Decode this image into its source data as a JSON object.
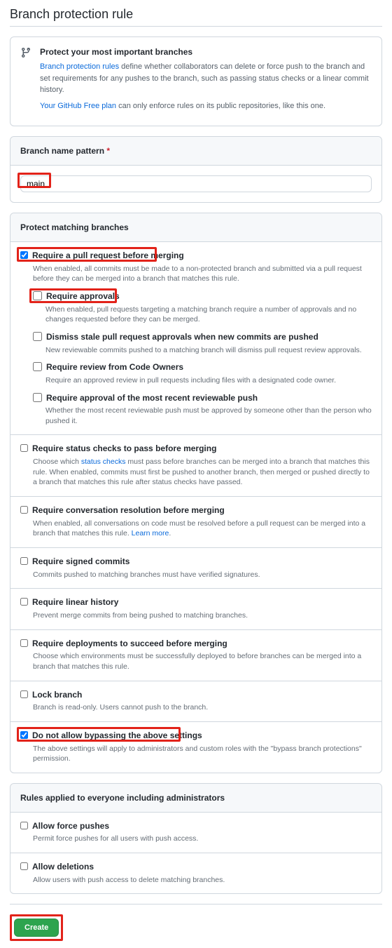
{
  "page_title": "Branch protection rule",
  "info": {
    "title": "Protect your most important branches",
    "link1": "Branch protection rules",
    "desc1": " define whether collaborators can delete or force push to the branch and set requirements for any pushes to the branch, such as passing status checks or a linear commit history.",
    "link2": "Your GitHub Free plan",
    "desc2": " can only enforce rules on its public repositories, like this one."
  },
  "pattern": {
    "header": "Branch name pattern",
    "value": "main"
  },
  "protect_header": "Protect matching branches",
  "rules": {
    "pr": {
      "label": "Require a pull request before merging",
      "desc": "When enabled, all commits must be made to a non-protected branch and submitted via a pull request before they can be merged into a branch that matches this rule."
    },
    "approvals": {
      "label": "Require approvals",
      "desc": "When enabled, pull requests targeting a matching branch require a number of approvals and no changes requested before they can be merged."
    },
    "dismiss": {
      "label": "Dismiss stale pull request approvals when new commits are pushed",
      "desc": "New reviewable commits pushed to a matching branch will dismiss pull request review approvals."
    },
    "codeowners": {
      "label": "Require review from Code Owners",
      "desc": "Require an approved review in pull requests including files with a designated code owner."
    },
    "lastpush": {
      "label": "Require approval of the most recent reviewable push",
      "desc": "Whether the most recent reviewable push must be approved by someone other than the person who pushed it."
    },
    "status": {
      "label": "Require status checks to pass before merging",
      "desc_a": "Choose which ",
      "link": "status checks",
      "desc_b": " must pass before branches can be merged into a branch that matches this rule. When enabled, commits must first be pushed to another branch, then merged or pushed directly to a branch that matches this rule after status checks have passed."
    },
    "convo": {
      "label": "Require conversation resolution before merging",
      "desc": "When enabled, all conversations on code must be resolved before a pull request can be merged into a branch that matches this rule. ",
      "link": "Learn more"
    },
    "signed": {
      "label": "Require signed commits",
      "desc": "Commits pushed to matching branches must have verified signatures."
    },
    "linear": {
      "label": "Require linear history",
      "desc": "Prevent merge commits from being pushed to matching branches."
    },
    "deploy": {
      "label": "Require deployments to succeed before merging",
      "desc": "Choose which environments must be successfully deployed to before branches can be merged into a branch that matches this rule."
    },
    "lock": {
      "label": "Lock branch",
      "desc": "Branch is read-only. Users cannot push to the branch."
    },
    "nobypass": {
      "label": "Do not allow bypassing the above settings",
      "desc": "The above settings will apply to administrators and custom roles with the \"bypass branch protections\" permission."
    }
  },
  "everyone_header": "Rules applied to everyone including administrators",
  "everyone": {
    "force": {
      "label": "Allow force pushes",
      "desc": "Permit force pushes for all users with push access."
    },
    "delete": {
      "label": "Allow deletions",
      "desc": "Allow users with push access to delete matching branches."
    }
  },
  "create_label": "Create"
}
